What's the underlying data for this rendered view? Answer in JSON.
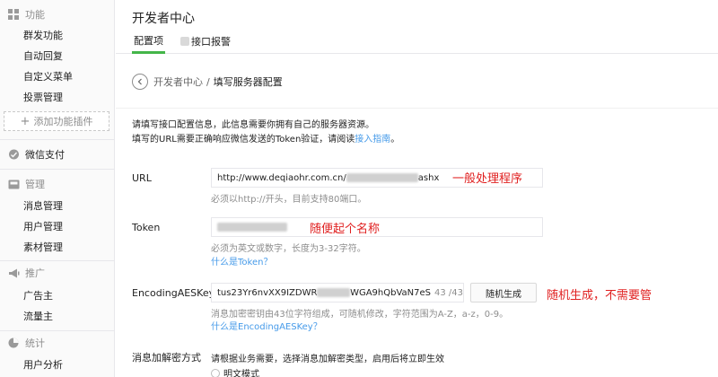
{
  "sidebar": {
    "sections": {
      "features": "功能",
      "payment": "微信支付",
      "manage": "管理",
      "promote": "推广",
      "stats": "统计"
    },
    "items": {
      "mass_send": "群发功能",
      "auto_reply": "自动回复",
      "custom_menu": "自定义菜单",
      "vote": "投票管理",
      "message_mgmt": "消息管理",
      "user_mgmt": "用户管理",
      "material_mgmt": "素材管理",
      "advertiser": "广告主",
      "traffic": "流量主",
      "user_analysis": "用户分析"
    },
    "add_plugin": "添加功能插件"
  },
  "header": {
    "title": "开发者中心",
    "tabs": [
      "配置项",
      "接口报警"
    ]
  },
  "breadcrumb": {
    "parent": "开发者中心",
    "separator": "/",
    "current": "填写服务器配置"
  },
  "intro": {
    "line1": "请填写接口配置信息，此信息需要你拥有自己的服务器资源。",
    "line2_prefix": "填写的URL需要正确响应微信发送的Token验证，请阅读",
    "line2_link": "接入指南",
    "line2_suffix": "。"
  },
  "form": {
    "url": {
      "label": "URL",
      "value_prefix": "http://www.deqiaohr.com.cn/",
      "value_suffix": "ashx",
      "hint": "必须以http://开头，目前支持80端口。",
      "annotation": "一般处理程序"
    },
    "token": {
      "label": "Token",
      "hint": "必须为英文或数字，长度为3-32字符。",
      "help_link": "什么是Token？",
      "annotation": "随便起个名称"
    },
    "aeskey": {
      "label": "EncodingAESKey",
      "value_prefix": "tus23Yr6nvXX9IZDWR",
      "value_suffix": "WGA9hQbVaN7eS",
      "count": "43 /43",
      "generate_button": "随机生成",
      "hint": "消息加密密钥由43位字符组成，可随机修改，字符范围为A-Z，a-z，0-9。",
      "help_link": "什么是EncodingAESKey？",
      "annotation": "随机生成，不需要管"
    },
    "encrypt": {
      "label": "消息加解密方式",
      "hint": "请根据业务需要，选择消息加解密类型，启用后将立即生效",
      "option_plain": "明文模式"
    }
  },
  "colors": {
    "accent": "#44b549",
    "link": "#459ae9",
    "annotation": "#e02020"
  }
}
